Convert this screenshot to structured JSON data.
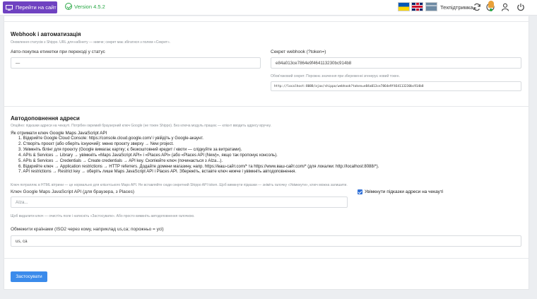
{
  "topbar": {
    "site_button": "Перейти на сайт",
    "version": "Version 4.5.2",
    "support": "Техпідтримка"
  },
  "webhook": {
    "title": "Webhook і автоматизація",
    "description": "Оновлення статусів з Shippo. URL для кабінету — нижче; секрет має збігатися з полем «Секрет».",
    "autobuy_label": "Авто-покупка етикетки при переході у статус",
    "autobuy_value": "—",
    "secret_label": "Секрет webhook (?token=)",
    "secret_value": "e84a013ce7864e9f464113230bc914b8",
    "secret_hint": "Обов'язковий секрет. Порожнє значення при збереженні згенерує новий токен.",
    "url": "http://localhost:8088/ajax/shippo/webhook?token=e84a013ce7864e9f464113230bc914b8"
  },
  "autocomplete": {
    "title": "Автодоповнення адреси",
    "description": "Опційно: підказки адреси на чекауті. Потрібен окремий браузерний ключ Google (не токен Shippo). Без ключа модуль працює — клієнт вводить адресу вручну.",
    "how_title": "Як отримати ключ Google Maps JavaScript API",
    "steps": [
      "1. Відкрийте Google Cloud Console: https://console.cloud.google.com/ і увійдіть у Google-акаунт.",
      "2. Створіть проєкт (або оберіть існуючий): меню проєкту зверху → New project.",
      "3. Увімкніть білінг для проєкту (Google вимагає картку; є безкоштовний кредит / квоти — слідкуйте за витратами).",
      "4. APIs & Services → Library → увімкніть «Maps JavaScript API» і «Places API» (або «Places API (New)», якщо так пропонує консоль).",
      "5. APIs & Services → Credentials → Create credentials → API key. Скопіюйте ключ (починається з AIza...).",
      "6. Відкрийте ключ → Application restrictions → HTTP referrers. Додайте домени магазину, напр. https://ваш-сайт.com/* та https://www.ваш-сайт.com/* (для локалки: http://localhost:8088/*).",
      "7. API restrictions → Restrict key → оберіть лише Maps JavaScript API і Places API. Збережіть, вставте ключ нижче і увімкніть автодоповнення."
    ],
    "key_note": "Ключ потрапляє в HTML вітрини — це нормально для клієнтського Maps API. Не вставляйте сюди секретний Shippo API token. Щоб вимкнути підказки — зніміть галочку «Увімкнути», ключ можна залишити.",
    "key_label": "Ключ Google Maps JavaScript API (для браузера, з Places)",
    "key_placeholder": "AIza...",
    "enable_label": "Увімкнути підказки адреси на чекауті",
    "delete_note": "Щоб видалити ключ — очистіть поле і натисніть «Застосувати». Або просто вимкніть автодоповнення галочкою.",
    "countries_label": "Обмежити країнами (ISO2 через кому, наприклад us,ca; порожньо = усі)",
    "countries_value": "us, ca"
  },
  "apply_button": "Застосувати",
  "colors": {
    "accent": "#3b8beb",
    "purple": "#6f42c1",
    "green": "#28a745"
  }
}
